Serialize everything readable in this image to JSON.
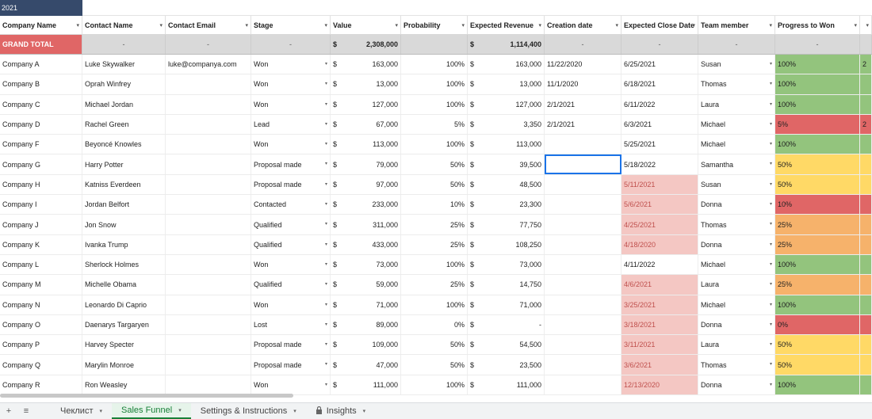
{
  "top": {
    "year": "2021"
  },
  "columns": [
    {
      "label": "Company Name",
      "filter": "▾"
    },
    {
      "label": "Contact Name",
      "filter": "▾"
    },
    {
      "label": "Contact Email",
      "filter": "▾"
    },
    {
      "label": "Stage",
      "filter": "▾"
    },
    {
      "label": "Value",
      "filter": "▾"
    },
    {
      "label": "Probability",
      "filter": "▾"
    },
    {
      "label": "Expected Revenue",
      "filter": "▾"
    },
    {
      "label": "Creation date",
      "filter": "▾"
    },
    {
      "label": "Expected Close Date",
      "filter": "▾"
    },
    {
      "label": "Team member",
      "filter": "▾"
    },
    {
      "label": "Progress to Won",
      "filter": "▾"
    },
    {
      "label": "",
      "filter": "▾"
    }
  ],
  "total": {
    "label": "GRAND TOTAL",
    "dash": "-",
    "currency": "$",
    "value": "2,308,000",
    "revenue": "1,114,400"
  },
  "rows": [
    {
      "company": "Company A",
      "contact": "Luke Skywalker",
      "email": "luke@companya.com",
      "stage": "Won",
      "value": "163,000",
      "prob": "100%",
      "revenue": "163,000",
      "created": "11/22/2020",
      "close": "6/25/2021",
      "close_overdue": false,
      "member": "Susan",
      "progress": "100%",
      "pclass": "p100"
    },
    {
      "company": "Company B",
      "contact": "Oprah Winfrey",
      "email": "",
      "stage": "Won",
      "value": "13,000",
      "prob": "100%",
      "revenue": "13,000",
      "created": "11/1/2020",
      "close": "6/18/2021",
      "close_overdue": false,
      "member": "Thomas",
      "progress": "100%",
      "pclass": "p100"
    },
    {
      "company": "Company C",
      "contact": "Michael Jordan",
      "email": "",
      "stage": "Won",
      "value": "127,000",
      "prob": "100%",
      "revenue": "127,000",
      "created": "2/1/2021",
      "close": "6/11/2022",
      "close_overdue": false,
      "member": "Laura",
      "progress": "100%",
      "pclass": "p100"
    },
    {
      "company": "Company D",
      "contact": "Rachel Green",
      "email": "",
      "stage": "Lead",
      "value": "67,000",
      "prob": "5%",
      "revenue": "3,350",
      "created": "2/1/2021",
      "close": "6/3/2021",
      "close_overdue": false,
      "member": "Michael",
      "progress": "5%",
      "pclass": "p5"
    },
    {
      "company": "Company F",
      "contact": "Beyoncé Knowles",
      "email": "",
      "stage": "Won",
      "value": "113,000",
      "prob": "100%",
      "revenue": "113,000",
      "created": "",
      "close": "5/25/2021",
      "close_overdue": false,
      "member": "Michael",
      "progress": "100%",
      "pclass": "p100"
    },
    {
      "company": "Company G",
      "contact": "Harry Potter",
      "email": "",
      "stage": "Proposal made",
      "value": "79,000",
      "prob": "50%",
      "revenue": "39,500",
      "created": "",
      "close": "5/18/2022",
      "close_overdue": false,
      "member": "Samantha",
      "progress": "50%",
      "pclass": "p50",
      "selected": true
    },
    {
      "company": "Company H",
      "contact": "Katniss Everdeen",
      "email": "",
      "stage": "Proposal made",
      "value": "97,000",
      "prob": "50%",
      "revenue": "48,500",
      "created": "",
      "close": "5/11/2021",
      "close_overdue": true,
      "member": "Susan",
      "progress": "50%",
      "pclass": "p50"
    },
    {
      "company": "Company I",
      "contact": "Jordan Belfort",
      "email": "",
      "stage": "Contacted",
      "value": "233,000",
      "prob": "10%",
      "revenue": "23,300",
      "created": "",
      "close": "5/6/2021",
      "close_overdue": true,
      "member": "Donna",
      "progress": "10%",
      "pclass": "p10"
    },
    {
      "company": "Company J",
      "contact": "Jon Snow",
      "email": "",
      "stage": "Qualified",
      "value": "311,000",
      "prob": "25%",
      "revenue": "77,750",
      "created": "",
      "close": "4/25/2021",
      "close_overdue": true,
      "member": "Thomas",
      "progress": "25%",
      "pclass": "p25"
    },
    {
      "company": "Company K",
      "contact": "Ivanka Trump",
      "email": "",
      "stage": "Qualified",
      "value": "433,000",
      "prob": "25%",
      "revenue": "108,250",
      "created": "",
      "close": "4/18/2020",
      "close_overdue": true,
      "member": "Donna",
      "progress": "25%",
      "pclass": "p25"
    },
    {
      "company": "Company L",
      "contact": "Sherlock Holmes",
      "email": "",
      "stage": "Won",
      "value": "73,000",
      "prob": "100%",
      "revenue": "73,000",
      "created": "",
      "close": "4/11/2022",
      "close_overdue": false,
      "member": "Michael",
      "progress": "100%",
      "pclass": "p100"
    },
    {
      "company": "Company M",
      "contact": "Michelle Obama",
      "email": "",
      "stage": "Qualified",
      "value": "59,000",
      "prob": "25%",
      "revenue": "14,750",
      "created": "",
      "close": "4/6/2021",
      "close_overdue": true,
      "member": "Laura",
      "progress": "25%",
      "pclass": "p25"
    },
    {
      "company": "Company N",
      "contact": "Leonardo Di Caprio",
      "email": "",
      "stage": "Won",
      "value": "71,000",
      "prob": "100%",
      "revenue": "71,000",
      "created": "",
      "close": "3/25/2021",
      "close_overdue": true,
      "member": "Michael",
      "progress": "100%",
      "pclass": "p100"
    },
    {
      "company": "Company O",
      "contact": "Daenarys Targaryen",
      "email": "",
      "stage": "Lost",
      "value": "89,000",
      "prob": "0%",
      "revenue": "-",
      "created": "",
      "close": "3/18/2021",
      "close_overdue": true,
      "member": "Donna",
      "progress": "0%",
      "pclass": "p0"
    },
    {
      "company": "Company P",
      "contact": "Harvey Specter",
      "email": "",
      "stage": "Proposal made",
      "value": "109,000",
      "prob": "50%",
      "revenue": "54,500",
      "created": "",
      "close": "3/11/2021",
      "close_overdue": true,
      "member": "Laura",
      "progress": "50%",
      "pclass": "p50"
    },
    {
      "company": "Company Q",
      "contact": "Marylin Monroe",
      "email": "",
      "stage": "Proposal made",
      "value": "47,000",
      "prob": "50%",
      "revenue": "23,500",
      "created": "",
      "close": "3/6/2021",
      "close_overdue": true,
      "member": "Thomas",
      "progress": "50%",
      "pclass": "p50"
    },
    {
      "company": "Company R",
      "contact": "Ron Weasley",
      "email": "",
      "stage": "Won",
      "value": "111,000",
      "prob": "100%",
      "revenue": "111,000",
      "created": "",
      "close": "12/13/2020",
      "close_overdue": true,
      "member": "Donna",
      "progress": "100%",
      "pclass": "p100"
    }
  ],
  "extra_col": [
    "2",
    "",
    "",
    "2",
    "",
    "",
    "",
    "",
    "",
    "",
    "",
    "",
    "",
    "",
    "",
    "",
    ""
  ],
  "tabs": {
    "add_icon": "+",
    "menu_icon": "≡",
    "items": [
      {
        "label": "Чеклист",
        "active": false,
        "arrow": "▾"
      },
      {
        "label": "Sales Funnel",
        "active": true,
        "arrow": "▾"
      },
      {
        "label": "Settings & Instructions",
        "active": false,
        "arrow": "▾"
      },
      {
        "label": "Insights",
        "active": false,
        "arrow": "▾",
        "locked": true
      }
    ]
  },
  "colors": {
    "header_dark": "#364a6b",
    "total_red": "#e06666",
    "won_green": "#93c47d",
    "overdue_pink": "#f4c7c3",
    "active_tab": "#188038"
  }
}
